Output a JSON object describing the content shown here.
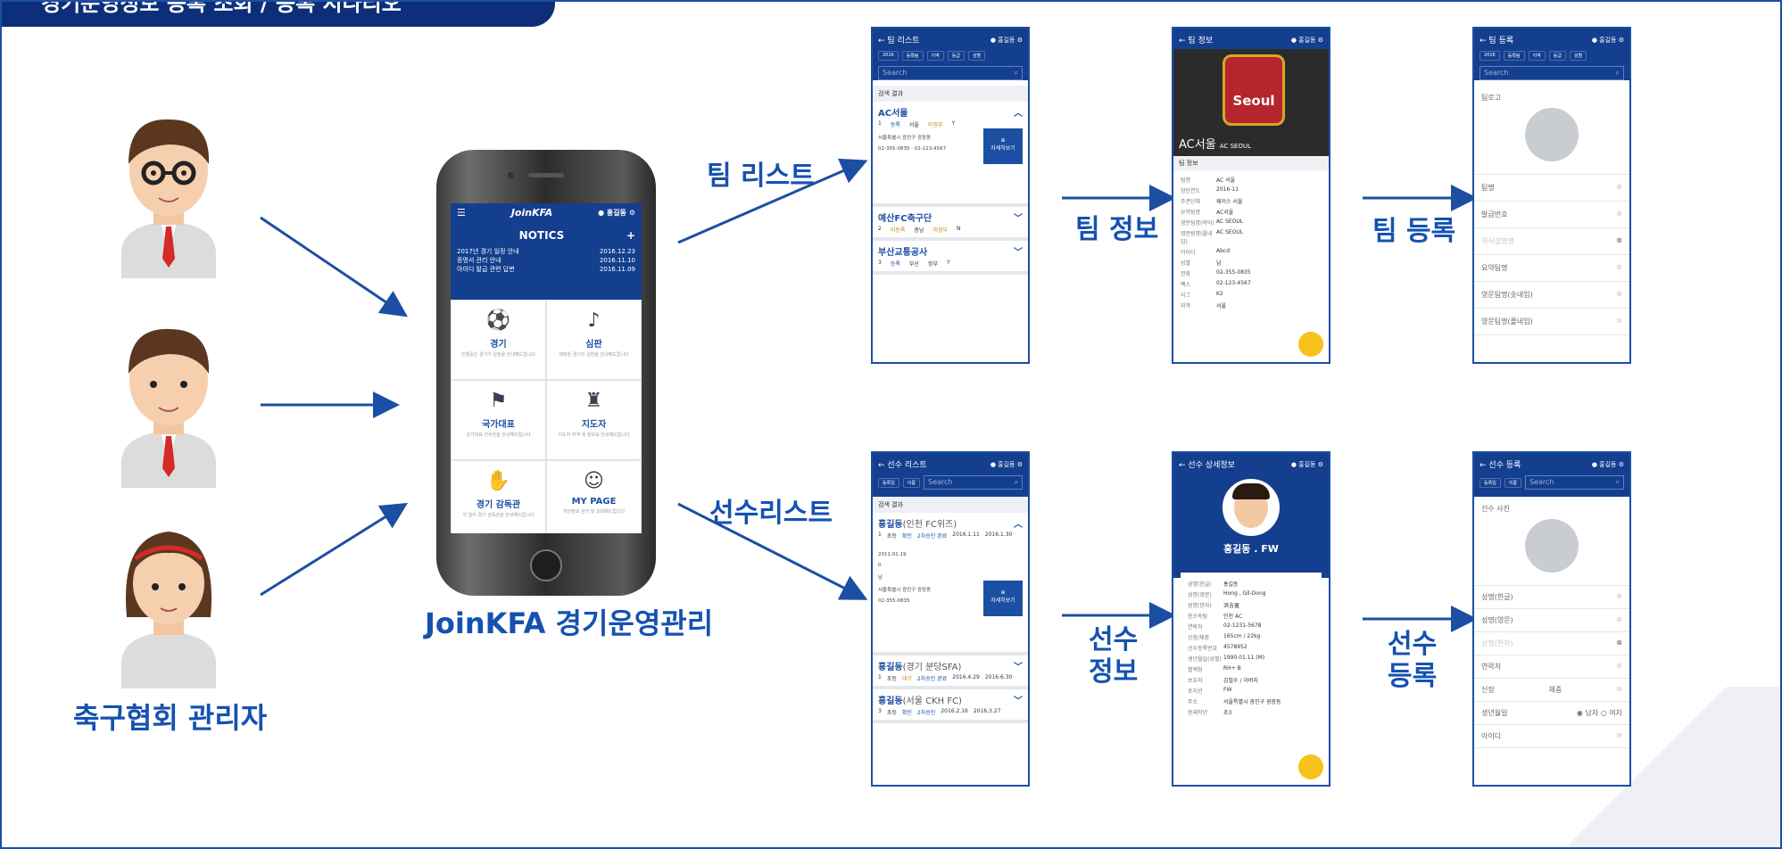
{
  "title": "경기운영정보 등록 조회 / 등록 시나리오",
  "persona": "축구협회 관리자",
  "app_caption": "JoinKFA 경기운영관리",
  "labels": {
    "team_list": "팀 리스트",
    "team_info": "팀 정보",
    "team_register": "팀 등록",
    "player_list": "선수리스트",
    "player_info": "선수\n정보",
    "player_register": "선수\n등록"
  },
  "phone": {
    "logo": "JoinKFA",
    "user": "홍길동",
    "notices_title": "NOTICS",
    "notices_plus": "+",
    "notices": [
      {
        "text": "2017년 경기 일정 안내",
        "date": "2016.12.23"
      },
      {
        "text": "증명서 관리 안내",
        "date": "2016.11.10"
      },
      {
        "text": "아이디 발급 관련 답변",
        "date": "2016.11.09"
      }
    ],
    "menu": [
      {
        "icon": "players-icon",
        "label": "경기",
        "sub": "진행중인 경기가 일정을 안내해드립니다"
      },
      {
        "icon": "whistle-icon",
        "label": "심판",
        "sub": "배정된 경기의 심판을 안내해드립니다"
      },
      {
        "icon": "flag-icon",
        "label": "국가대표",
        "sub": "국가대표 선수진을 안내해드립니다"
      },
      {
        "icon": "coach-icon",
        "label": "지도자",
        "sub": "지도자 자격 및 정보를 안내해드립니다"
      },
      {
        "icon": "hand-icon",
        "label": "경기 감독관",
        "sub": "각 일지 경기 감독관을 안내해드립니다"
      },
      {
        "icon": "mypage-icon",
        "label": "MY PAGE",
        "sub": "개인정보 관리 및 조회해드립니다"
      }
    ]
  },
  "team_list_screen": {
    "title": "팀 리스트",
    "user": "홍길동",
    "filters": [
      "2016",
      "등록팀",
      "지역",
      "등급",
      "성별"
    ],
    "search": "Search",
    "result": "검색 결과",
    "teams": [
      {
        "name": "AC서울",
        "no": "1",
        "status": "등록",
        "region": "서울",
        "grade": "미정부",
        "yn": "Y"
      },
      {
        "name": "예산FC축구단",
        "no": "2",
        "status": "미등록",
        "region": "충남",
        "grade": "미정부",
        "yn": "N"
      },
      {
        "name": "부산교통공사",
        "no": "3",
        "status": "등록",
        "region": "부산",
        "grade": "정부",
        "yn": "Y"
      }
    ],
    "address": "서울특별시 광진구 광장동",
    "phone": "02-355-0835",
    "fax": "02-123-4567",
    "detail_button": "자세히보기"
  },
  "team_info_screen": {
    "title": "팀 정보",
    "user": "홍길동",
    "badge": "Seoul",
    "team_name": "AC서울",
    "team_name_en": "AC SEOUL",
    "section": "팀 정보",
    "rows": [
      {
        "k": "팀명",
        "v": "AC 서울"
      },
      {
        "k": "창단연도",
        "v": "2016-11"
      },
      {
        "k": "주관단체",
        "v": "웨이스 서울"
      },
      {
        "k": "요약팀명",
        "v": "AC서울"
      },
      {
        "k": "영문팀명(약어)",
        "v": "AC SEOUL"
      },
      {
        "k": "영문팀명(풀네임)",
        "v": "AC SEOUL"
      },
      {
        "k": "아이디",
        "v": "Abcd"
      },
      {
        "k": "성별",
        "v": "남"
      },
      {
        "k": "전화",
        "v": "02-355-0835"
      },
      {
        "k": "팩스",
        "v": "02-123-4567"
      },
      {
        "k": "리그",
        "v": "K2"
      },
      {
        "k": "지역",
        "v": "서울"
      }
    ]
  },
  "team_register_screen": {
    "title": "팀 등록",
    "user": "홍길동",
    "filters": [
      "2016",
      "등록팀",
      "지역",
      "등급",
      "성별"
    ],
    "search": "Search",
    "logo_label": "팀로고",
    "fields": [
      "팀명",
      "발급번호",
      "약식설명명",
      "요약팀명",
      "영문팀명(숏네임)",
      "영문팀명(풀네임)"
    ]
  },
  "player_list_screen": {
    "title": "선수 리스트",
    "user": "홍길동",
    "filters": [
      "등록일",
      "이름"
    ],
    "search": "Search",
    "result": "검색 결과",
    "players": [
      {
        "name": "홍길동",
        "team": "(인천 FC위즈)",
        "no": "1",
        "status": "초등",
        "reg": "확인",
        "appr": "2차승인 완료",
        "d1": "2016.1.11",
        "d2": "2016.1.30"
      },
      {
        "name": "홍길동",
        "team": "(경기 분당SFA)",
        "no": "1",
        "status": "초등",
        "reg": "대기",
        "appr": "2차승인 완료",
        "d1": "2016.4.29",
        "d2": "2016.6.30"
      },
      {
        "name": "홍길동",
        "team": "(서울 CKH FC)",
        "no": "3",
        "status": "초등",
        "reg": "확인",
        "appr": "2차승인",
        "d1": "2016.2.16",
        "d2": "2016.3.27"
      }
    ],
    "birth": "2011.01.19",
    "backno": "0",
    "gender": "남",
    "address": "서울특별시 광진구 광장동",
    "phone": "02-355-0835",
    "detail_button": "자세히보기"
  },
  "player_info_screen": {
    "title": "선수 상세정보",
    "user": "홍길동",
    "name_pos": "홍길동 . FW",
    "rows": [
      {
        "k": "성명(한글)",
        "v": "홍길동"
      },
      {
        "k": "성명(영문)",
        "v": "Hong , Gil-Dong"
      },
      {
        "k": "성명(한자)",
        "v": "洪吉童"
      },
      {
        "k": "현소속팀",
        "v": "인천 AC"
      },
      {
        "k": "연락처",
        "v": "02-1231-5678"
      },
      {
        "k": "신장/체중",
        "v": "165cm / 22kg"
      },
      {
        "k": "선수등록번호",
        "v": "4578952"
      },
      {
        "k": "생년월일(성별)",
        "v": "1990.01.11 (M)"
      },
      {
        "k": "혈액형",
        "v": "RH+ B"
      },
      {
        "k": "보호자",
        "v": "김철수 / 아버지"
      },
      {
        "k": "포지션",
        "v": "FW"
      },
      {
        "k": "주소",
        "v": "서울특별시 광진구 광장동"
      },
      {
        "k": "현재학년",
        "v": "초3"
      }
    ]
  },
  "player_register_screen": {
    "title": "선수 등록",
    "user": "홍길동",
    "filters": [
      "등록일",
      "이름"
    ],
    "search": "Search",
    "photo_label": "선수 사진",
    "fields": [
      "성명(한글)",
      "성명(영문)",
      "성명(한자)",
      "연락처"
    ],
    "height": "신장",
    "weight": "체중",
    "birth": "생년월일",
    "male": "남자",
    "female": "여자",
    "id": "아이디"
  }
}
